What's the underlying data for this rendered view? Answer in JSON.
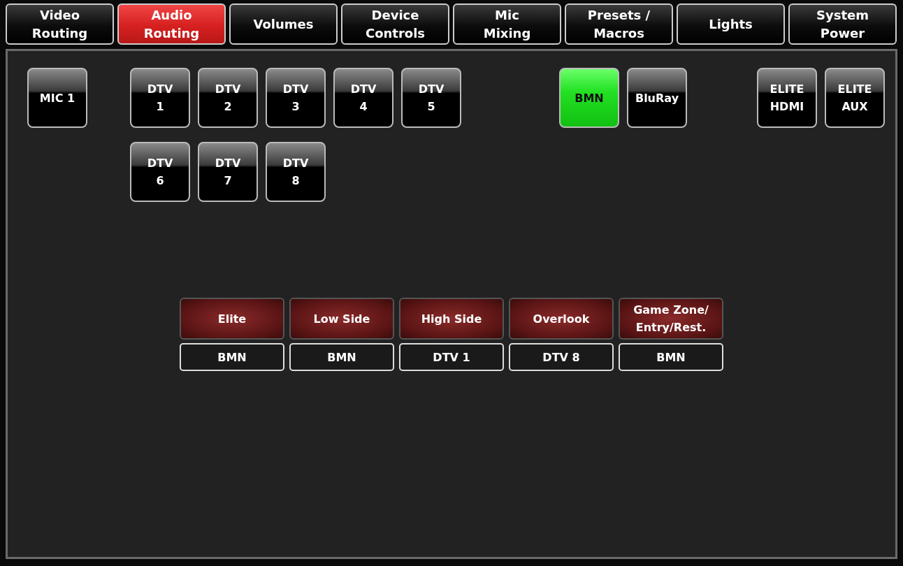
{
  "tabs": [
    {
      "label": "Video\nRouting",
      "selected": false
    },
    {
      "label": "Audio\nRouting",
      "selected": true
    },
    {
      "label": "Volumes",
      "selected": false
    },
    {
      "label": "Device\nControls",
      "selected": false
    },
    {
      "label": "Mic\nMixing",
      "selected": false
    },
    {
      "label": "Presets /\nMacros",
      "selected": false
    },
    {
      "label": "Lights",
      "selected": false
    },
    {
      "label": "System\nPower",
      "selected": false
    }
  ],
  "source_groups": [
    {
      "sources": [
        {
          "label": "MIC 1",
          "selected": false
        }
      ]
    },
    {
      "sources": [
        {
          "label": "DTV\n1",
          "selected": false
        },
        {
          "label": "DTV\n2",
          "selected": false
        },
        {
          "label": "DTV\n3",
          "selected": false
        },
        {
          "label": "DTV\n4",
          "selected": false
        },
        {
          "label": "DTV\n5",
          "selected": false
        },
        {
          "label": "DTV\n6",
          "selected": false
        },
        {
          "label": "DTV\n7",
          "selected": false
        },
        {
          "label": "DTV\n8",
          "selected": false
        }
      ]
    },
    {
      "sources": [
        {
          "label": "BMN",
          "selected": true
        },
        {
          "label": "BluRay",
          "selected": false
        }
      ]
    },
    {
      "sources": [
        {
          "label": "ELITE\nHDMI",
          "selected": false
        },
        {
          "label": "ELITE\nAUX",
          "selected": false
        }
      ]
    }
  ],
  "zones": [
    {
      "label": "Elite",
      "source": "BMN"
    },
    {
      "label": "Low Side",
      "source": "BMN"
    },
    {
      "label": "High Side",
      "source": "DTV 1"
    },
    {
      "label": "Overlook",
      "source": "DTV 8"
    },
    {
      "label": "Game Zone/\nEntry/Rest.",
      "source": "BMN"
    }
  ]
}
